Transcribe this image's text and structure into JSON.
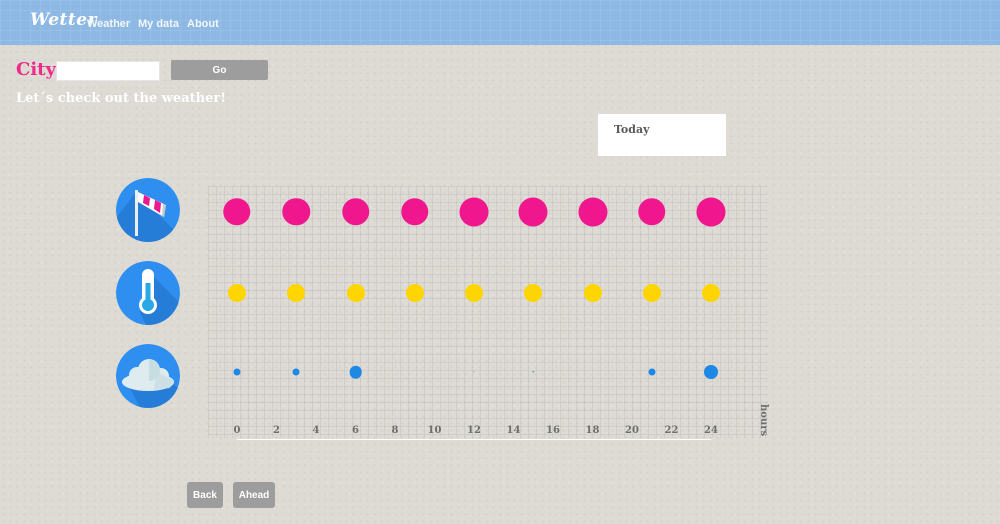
{
  "navbar": {
    "brand": "Wetter",
    "links": [
      "Weather",
      "My data",
      "About"
    ],
    "color": "#8db8e4"
  },
  "search": {
    "label": "City",
    "input_value": "",
    "placeholder": "",
    "go_label": "Go"
  },
  "tagline": "Let´s check out the weather!",
  "today": {
    "label": "Today"
  },
  "rows": [
    {
      "icon": "windsock-icon",
      "color": "#f0168e"
    },
    {
      "icon": "thermometer-icon",
      "color": "#ffd500"
    },
    {
      "icon": "cloud-icon",
      "color": "#1e88e5"
    }
  ],
  "chart_data": {
    "type": "scatter",
    "x": [
      0,
      3,
      6,
      9,
      12,
      15,
      18,
      21,
      24
    ],
    "xticks": [
      0,
      2,
      4,
      6,
      8,
      10,
      12,
      14,
      16,
      18,
      20,
      22,
      24
    ],
    "xlabel": "hours",
    "series": [
      {
        "values": [
          0.9,
          0.9,
          0.9,
          0.9,
          0.95,
          0.95,
          0.95,
          0.9,
          0.95
        ]
      },
      {
        "values": [
          0.55,
          0.55,
          0.55,
          0.55,
          0.55,
          0.55,
          0.55,
          0.55,
          0.55
        ]
      },
      {
        "values": [
          0.25,
          0.25,
          0.45,
          0,
          0.05,
          0.05,
          0,
          0.25,
          0.5
        ]
      }
    ]
  },
  "footer": {
    "back_label": "Back",
    "ahead_label": "Ahead"
  }
}
